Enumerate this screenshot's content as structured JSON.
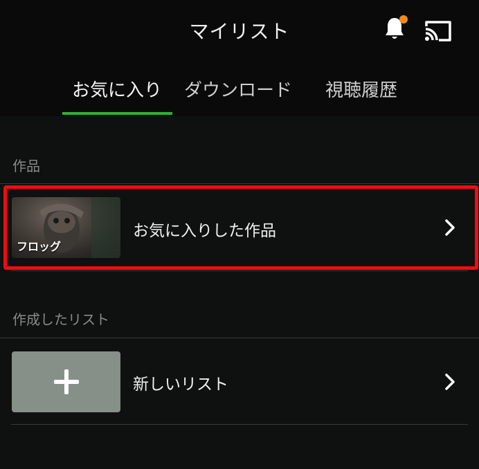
{
  "header": {
    "title": "マイリスト",
    "notification_dot_color": "#f08a1c",
    "icons": [
      "bell-icon",
      "cast-icon"
    ]
  },
  "tabs": [
    {
      "label": "お気に入り",
      "active": true
    },
    {
      "label": "ダウンロード",
      "active": false
    },
    {
      "label": "視聴履歴",
      "active": false
    }
  ],
  "accent_color": "#2fb12f",
  "sections": {
    "works": {
      "label": "作品",
      "items": [
        {
          "label": "お気に入りした作品",
          "thumbnail_caption": "フロッグ",
          "highlighted": true
        }
      ]
    },
    "created_lists": {
      "label": "作成したリスト",
      "items": [
        {
          "label": "新しいリスト",
          "icon": "plus-icon"
        }
      ]
    }
  },
  "highlight_color": "#ee0d12"
}
